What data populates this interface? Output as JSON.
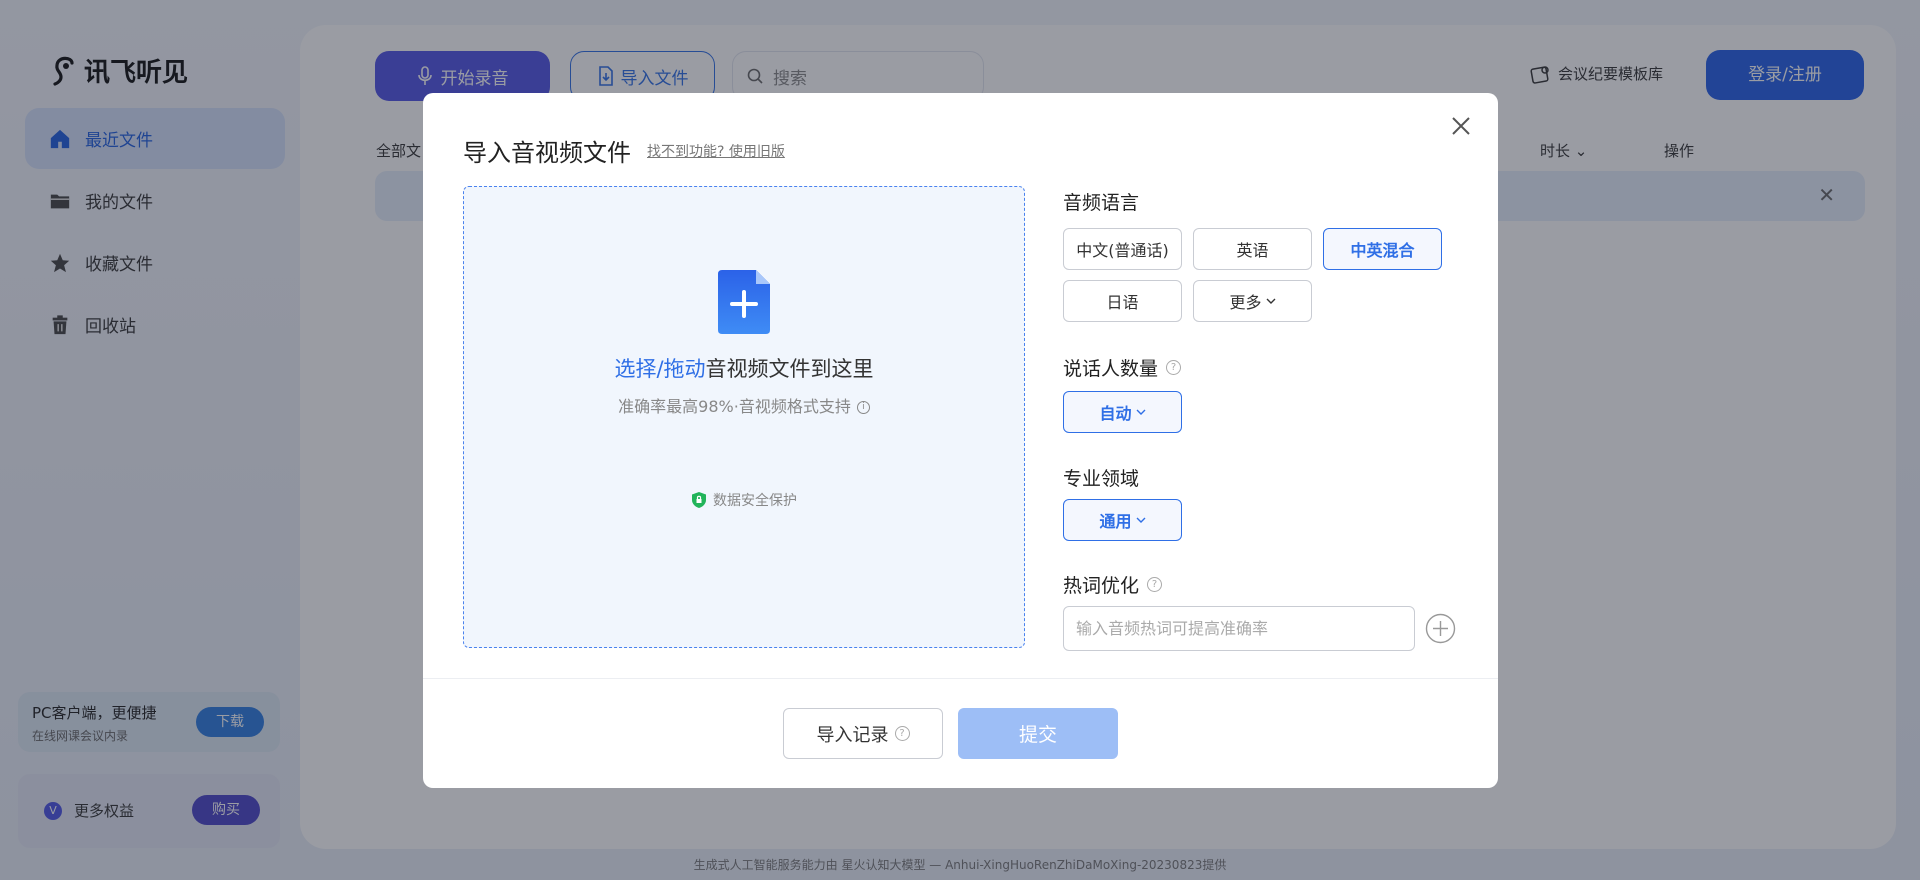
{
  "app": {
    "logo_text": "讯飞听见",
    "nav": [
      {
        "label": "最近文件",
        "icon": "home-icon",
        "active": true
      },
      {
        "label": "我的文件",
        "icon": "folder-icon"
      },
      {
        "label": "收藏文件",
        "icon": "star-icon"
      },
      {
        "label": "回收站",
        "icon": "trash-icon"
      }
    ],
    "promo": {
      "title": "PC客户端，更便捷",
      "subtitle": "在线网课会议内录",
      "button": "下载"
    },
    "vip": {
      "badge": "V",
      "label": "更多权益",
      "button": "购买"
    },
    "toolbar": {
      "record_label": "开始录音",
      "import_label": "导入文件",
      "search_placeholder": "搜索",
      "template_label": "会议纪要模板库",
      "login_label": "登录/注册"
    },
    "table_headers": {
      "all": "全部文",
      "duration": "时长",
      "actions": "操作"
    },
    "footer_note": "生成式人工智能服务能力由 星火认知大模型 — Anhui-XingHuoRenZhiDaMoXing-20230823提供"
  },
  "modal": {
    "title": "导入音视频文件",
    "legacy_link": "找不到功能? 使用旧版",
    "dropzone": {
      "highlight": "选择/拖动",
      "text": "音视频文件到这里",
      "subtext": "准确率最高98%·音视频格式支持",
      "secure": "数据安全保护"
    },
    "language": {
      "label": "音频语言",
      "options": [
        "中文(普通话)",
        "英语",
        "中英混合",
        "日语",
        "更多"
      ],
      "selected": "中英混合"
    },
    "speakers": {
      "label": "说话人数量",
      "value": "自动"
    },
    "domain": {
      "label": "专业领域",
      "value": "通用"
    },
    "hotwords": {
      "label": "热词优化",
      "placeholder": "输入音频热词可提高准确率"
    },
    "footer": {
      "history": "导入记录",
      "submit": "提交"
    },
    "accent_color": "#2f6fe6"
  }
}
